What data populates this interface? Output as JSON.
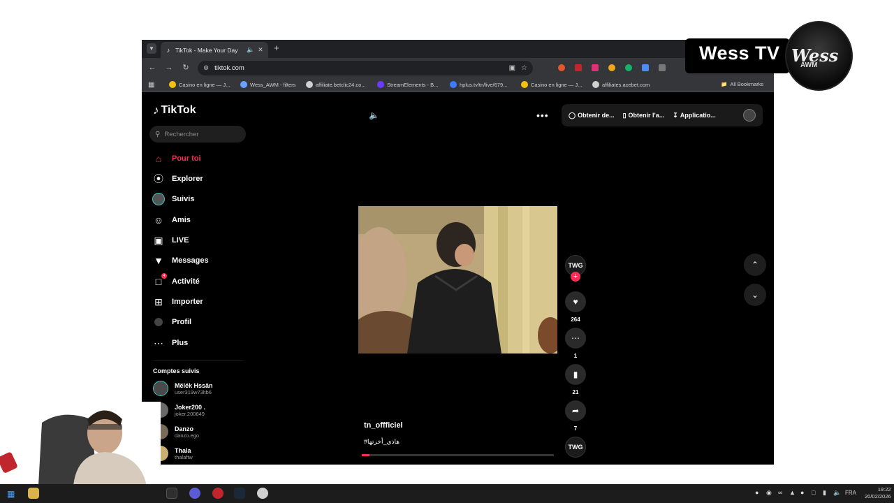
{
  "browser": {
    "tab_title": "TikTok - Make Your Day",
    "url": "tiktok.com",
    "new_tab": "+",
    "bookmarks": [
      {
        "label": "Casino en ligne — J...",
        "color": "#f4c20d"
      },
      {
        "label": "Wess_AWM - filters",
        "color": "#6aa0ff"
      },
      {
        "label": "affiliate.betclic24.co...",
        "color": "#cfcfcf"
      },
      {
        "label": "StreamElements - B...",
        "color": "#6b3cff"
      },
      {
        "label": "hplus.tv/tn/live/679...",
        "color": "#3b7bff"
      },
      {
        "label": "Casino en ligne — J...",
        "color": "#f4c20d"
      },
      {
        "label": "affiliates.acebet.com",
        "color": "#cfcfcf"
      }
    ],
    "all_bookmarks": "All Bookmarks"
  },
  "tiktok": {
    "logo": "TikTok",
    "search_placeholder": "Rechercher",
    "nav": [
      {
        "label": "Pour toi",
        "icon": "home-icon"
      },
      {
        "label": "Explorer",
        "icon": "compass-icon"
      },
      {
        "label": "Suivis",
        "icon": "following-avatar-icon"
      },
      {
        "label": "Amis",
        "icon": "friends-icon"
      },
      {
        "label": "LIVE",
        "icon": "live-icon"
      },
      {
        "label": "Messages",
        "icon": "messages-icon"
      },
      {
        "label": "Activité",
        "icon": "activity-icon",
        "badge": "4"
      },
      {
        "label": "Importer",
        "icon": "upload-icon"
      },
      {
        "label": "Profil",
        "icon": "profile-icon"
      },
      {
        "label": "Plus",
        "icon": "more-icon"
      }
    ],
    "followed_title": "Comptes suivis",
    "followed": [
      {
        "name": "Mëlëk Hssân",
        "handle": "user319w73ltb6"
      },
      {
        "name": "Joker200 .",
        "handle": "joker.200849"
      },
      {
        "name": "Danzo",
        "handle": "danzo.ego"
      },
      {
        "name": "Thala",
        "handle": "thalaftw"
      }
    ],
    "top_buttons": {
      "coins": "Obtenir de...",
      "app": "Obtenir l'a...",
      "download": "Applicatio..."
    },
    "video": {
      "author": "tn_offficiel",
      "caption": "#هاذي_أخرتها",
      "progress": 0.04,
      "creator_avatar": "TWG",
      "likes": "264",
      "comments": "1",
      "saves": "21",
      "shares": "7"
    }
  },
  "overlay": {
    "title": "Wess TV",
    "badge": "Wess",
    "badge_sub": "AWM"
  },
  "taskbar": {
    "lang": "FRA",
    "time": "19:22",
    "date": "20/02/2026"
  }
}
